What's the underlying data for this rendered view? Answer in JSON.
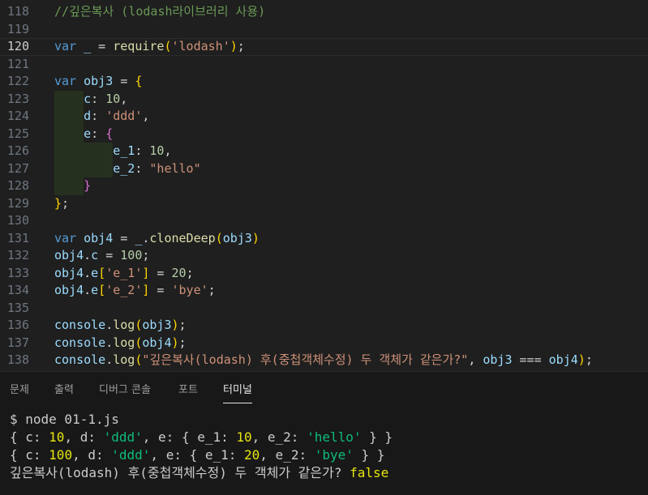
{
  "editor": {
    "active_line": 120,
    "lines": [
      {
        "n": "118",
        "tokens": [
          {
            "t": "//깊은복사 (lodash라이브러리 사용)",
            "c": "cmt"
          }
        ]
      },
      {
        "n": "119",
        "tokens": []
      },
      {
        "n": "120",
        "tokens": [
          {
            "t": "var",
            "c": "kw"
          },
          {
            "t": " ",
            "c": "plain"
          },
          {
            "t": "_",
            "c": "var"
          },
          {
            "t": " = ",
            "c": "op"
          },
          {
            "t": "require",
            "c": "fn"
          },
          {
            "t": "(",
            "c": "b1"
          },
          {
            "t": "'lodash'",
            "c": "str"
          },
          {
            "t": ")",
            "c": "b1"
          },
          {
            "t": ";",
            "c": "plain"
          }
        ]
      },
      {
        "n": "121",
        "tokens": []
      },
      {
        "n": "122",
        "tokens": [
          {
            "t": "var",
            "c": "kw"
          },
          {
            "t": " ",
            "c": "plain"
          },
          {
            "t": "obj3",
            "c": "var"
          },
          {
            "t": " = ",
            "c": "op"
          },
          {
            "t": "{",
            "c": "b1"
          }
        ]
      },
      {
        "n": "123",
        "tokens": [
          {
            "t": "    ",
            "c": "plain"
          },
          {
            "t": "c",
            "c": "var"
          },
          {
            "t": ": ",
            "c": "plain"
          },
          {
            "t": "10",
            "c": "num"
          },
          {
            "t": ",",
            "c": "plain"
          }
        ]
      },
      {
        "n": "124",
        "tokens": [
          {
            "t": "    ",
            "c": "plain"
          },
          {
            "t": "d",
            "c": "var"
          },
          {
            "t": ": ",
            "c": "plain"
          },
          {
            "t": "'ddd'",
            "c": "str"
          },
          {
            "t": ",",
            "c": "plain"
          }
        ]
      },
      {
        "n": "125",
        "tokens": [
          {
            "t": "    ",
            "c": "plain"
          },
          {
            "t": "e",
            "c": "var"
          },
          {
            "t": ": ",
            "c": "plain"
          },
          {
            "t": "{",
            "c": "b2"
          }
        ]
      },
      {
        "n": "126",
        "tokens": [
          {
            "t": "        ",
            "c": "plain"
          },
          {
            "t": "e_1",
            "c": "var"
          },
          {
            "t": ": ",
            "c": "plain"
          },
          {
            "t": "10",
            "c": "num"
          },
          {
            "t": ",",
            "c": "plain"
          }
        ]
      },
      {
        "n": "127",
        "tokens": [
          {
            "t": "        ",
            "c": "plain"
          },
          {
            "t": "e_2",
            "c": "var"
          },
          {
            "t": ": ",
            "c": "plain"
          },
          {
            "t": "\"hello\"",
            "c": "str"
          }
        ]
      },
      {
        "n": "128",
        "tokens": [
          {
            "t": "    ",
            "c": "plain"
          },
          {
            "t": "}",
            "c": "b2"
          }
        ]
      },
      {
        "n": "129",
        "tokens": [
          {
            "t": "}",
            "c": "b1"
          },
          {
            "t": ";",
            "c": "plain"
          }
        ]
      },
      {
        "n": "130",
        "tokens": []
      },
      {
        "n": "131",
        "tokens": [
          {
            "t": "var",
            "c": "kw"
          },
          {
            "t": " ",
            "c": "plain"
          },
          {
            "t": "obj4",
            "c": "var"
          },
          {
            "t": " = ",
            "c": "op"
          },
          {
            "t": "_",
            "c": "var"
          },
          {
            "t": ".",
            "c": "plain"
          },
          {
            "t": "cloneDeep",
            "c": "fn"
          },
          {
            "t": "(",
            "c": "b1"
          },
          {
            "t": "obj3",
            "c": "var"
          },
          {
            "t": ")",
            "c": "b1"
          }
        ]
      },
      {
        "n": "132",
        "tokens": [
          {
            "t": "obj4",
            "c": "var"
          },
          {
            "t": ".",
            "c": "plain"
          },
          {
            "t": "c",
            "c": "var"
          },
          {
            "t": " = ",
            "c": "op"
          },
          {
            "t": "100",
            "c": "num"
          },
          {
            "t": ";",
            "c": "plain"
          }
        ]
      },
      {
        "n": "133",
        "tokens": [
          {
            "t": "obj4",
            "c": "var"
          },
          {
            "t": ".",
            "c": "plain"
          },
          {
            "t": "e",
            "c": "var"
          },
          {
            "t": "[",
            "c": "b1"
          },
          {
            "t": "'e_1'",
            "c": "str"
          },
          {
            "t": "]",
            "c": "b1"
          },
          {
            "t": " = ",
            "c": "op"
          },
          {
            "t": "20",
            "c": "num"
          },
          {
            "t": ";",
            "c": "plain"
          }
        ]
      },
      {
        "n": "134",
        "tokens": [
          {
            "t": "obj4",
            "c": "var"
          },
          {
            "t": ".",
            "c": "plain"
          },
          {
            "t": "e",
            "c": "var"
          },
          {
            "t": "[",
            "c": "b1"
          },
          {
            "t": "'e_2'",
            "c": "str"
          },
          {
            "t": "]",
            "c": "b1"
          },
          {
            "t": " = ",
            "c": "op"
          },
          {
            "t": "'bye'",
            "c": "str"
          },
          {
            "t": ";",
            "c": "plain"
          }
        ]
      },
      {
        "n": "135",
        "tokens": []
      },
      {
        "n": "136",
        "tokens": [
          {
            "t": "console",
            "c": "var"
          },
          {
            "t": ".",
            "c": "plain"
          },
          {
            "t": "log",
            "c": "fn"
          },
          {
            "t": "(",
            "c": "b1"
          },
          {
            "t": "obj3",
            "c": "var"
          },
          {
            "t": ")",
            "c": "b1"
          },
          {
            "t": ";",
            "c": "plain"
          }
        ]
      },
      {
        "n": "137",
        "tokens": [
          {
            "t": "console",
            "c": "var"
          },
          {
            "t": ".",
            "c": "plain"
          },
          {
            "t": "log",
            "c": "fn"
          },
          {
            "t": "(",
            "c": "b1"
          },
          {
            "t": "obj4",
            "c": "var"
          },
          {
            "t": ")",
            "c": "b1"
          },
          {
            "t": ";",
            "c": "plain"
          }
        ]
      },
      {
        "n": "138",
        "tokens": [
          {
            "t": "console",
            "c": "var"
          },
          {
            "t": ".",
            "c": "plain"
          },
          {
            "t": "log",
            "c": "fn"
          },
          {
            "t": "(",
            "c": "b1"
          },
          {
            "t": "\"깊은복사(lodash) 후(중첩객체수정) 두 객체가 같은가?\"",
            "c": "str"
          },
          {
            "t": ", ",
            "c": "plain"
          },
          {
            "t": "obj3",
            "c": "var"
          },
          {
            "t": " === ",
            "c": "op"
          },
          {
            "t": "obj4",
            "c": "var"
          },
          {
            "t": ")",
            "c": "b1"
          },
          {
            "t": ";",
            "c": "plain"
          }
        ]
      }
    ]
  },
  "panel": {
    "tabs": [
      {
        "label": "문제",
        "active": false
      },
      {
        "label": "출력",
        "active": false
      },
      {
        "label": "디버그 콘솔",
        "active": false
      },
      {
        "label": "포트",
        "active": false
      },
      {
        "label": "터미널",
        "active": true
      }
    ]
  },
  "terminal": {
    "lines": [
      [
        {
          "t": "$ node 01-1.js",
          "c": "plain"
        }
      ],
      [
        {
          "t": "{ c: ",
          "c": "plain"
        },
        {
          "t": "10",
          "c": "num"
        },
        {
          "t": ", d: ",
          "c": "plain"
        },
        {
          "t": "'ddd'",
          "c": "str"
        },
        {
          "t": ", e: { e_1: ",
          "c": "plain"
        },
        {
          "t": "10",
          "c": "num"
        },
        {
          "t": ", e_2: ",
          "c": "plain"
        },
        {
          "t": "'hello'",
          "c": "str"
        },
        {
          "t": " } }",
          "c": "plain"
        }
      ],
      [
        {
          "t": "{ c: ",
          "c": "plain"
        },
        {
          "t": "100",
          "c": "num"
        },
        {
          "t": ", d: ",
          "c": "plain"
        },
        {
          "t": "'ddd'",
          "c": "str"
        },
        {
          "t": ", e: { e_1: ",
          "c": "plain"
        },
        {
          "t": "20",
          "c": "num"
        },
        {
          "t": ", e_2: ",
          "c": "plain"
        },
        {
          "t": "'bye'",
          "c": "str"
        },
        {
          "t": " } }",
          "c": "plain"
        }
      ],
      [
        {
          "t": "깊은복사(lodash) 후(중첩객체수정) 두 객체가 같은가? ",
          "c": "plain"
        },
        {
          "t": "false",
          "c": "bool"
        }
      ]
    ]
  }
}
